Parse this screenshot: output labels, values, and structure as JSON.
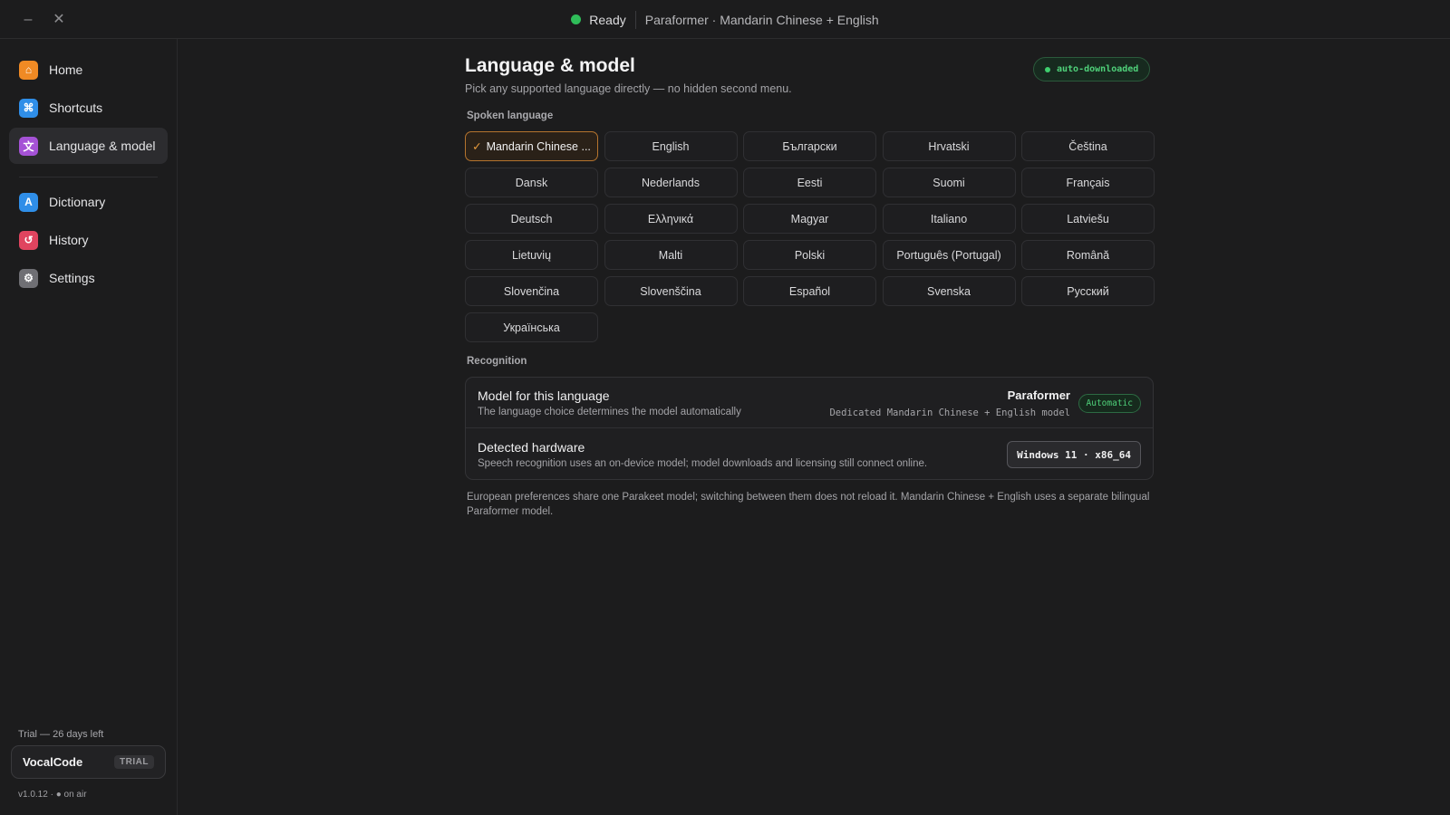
{
  "window": {
    "minimize_glyph": "–",
    "close_glyph": "✕",
    "status": "Ready",
    "status_color": "#2fbd59",
    "model_summary": "Paraformer · Mandarin Chinese + English"
  },
  "sidebar": {
    "items": [
      {
        "label": "Home",
        "icon": "home-icon",
        "glyph": "⌂",
        "color": "#f08a24"
      },
      {
        "label": "Shortcuts",
        "icon": "command-icon",
        "glyph": "⌘",
        "color": "#2f8ee8"
      },
      {
        "label": "Language & model",
        "icon": "translate-icon",
        "glyph": "文",
        "color": "#a552d6",
        "active": true
      },
      {
        "label": "Dictionary",
        "icon": "dictionary-icon",
        "glyph": "A",
        "color": "#2f8ee8"
      },
      {
        "label": "History",
        "icon": "history-icon",
        "glyph": "↺",
        "color": "#e0445f"
      },
      {
        "label": "Settings",
        "icon": "gear-icon",
        "glyph": "⚙",
        "color": "#6f6f74"
      }
    ],
    "trial_text": "Trial — 26 days left",
    "brand": "VocalCode",
    "brand_badge": "TRIAL",
    "version": "v1.0.12 · ● on air"
  },
  "main": {
    "title": "Language & model",
    "subtitle": "Pick any supported language directly — no hidden second menu.",
    "auto_pill": "auto-downloaded",
    "spoken_label": "Spoken language",
    "selected_check": "✓",
    "languages": [
      "Mandarin Chinese ...",
      "English",
      "Български",
      "Hrvatski",
      "Čeština",
      "Dansk",
      "Nederlands",
      "Eesti",
      "Suomi",
      "Français",
      "Deutsch",
      "Ελληνικά",
      "Magyar",
      "Italiano",
      "Latviešu",
      "Lietuvių",
      "Malti",
      "Polski",
      "Português (Portugal)",
      "Română",
      "Slovenčina",
      "Slovenščina",
      "Español",
      "Svenska",
      "Русский",
      "Українська"
    ],
    "selected_language_index": 0,
    "recognition_label": "Recognition",
    "model_row": {
      "title": "Model for this language",
      "desc": "The language choice determines the model automatically",
      "model_name": "Paraformer",
      "model_desc": "Dedicated Mandarin Chinese + English model",
      "badge": "Automatic"
    },
    "hardware_row": {
      "title": "Detected hardware",
      "desc": "Speech recognition uses an on-device model; model downloads and licensing still connect online.",
      "badge": "Windows 11 · x86_64"
    },
    "footnote": "European preferences share one Parakeet model; switching between them does not reload it. Mandarin Chinese + English uses a separate bilingual Paraformer model."
  }
}
